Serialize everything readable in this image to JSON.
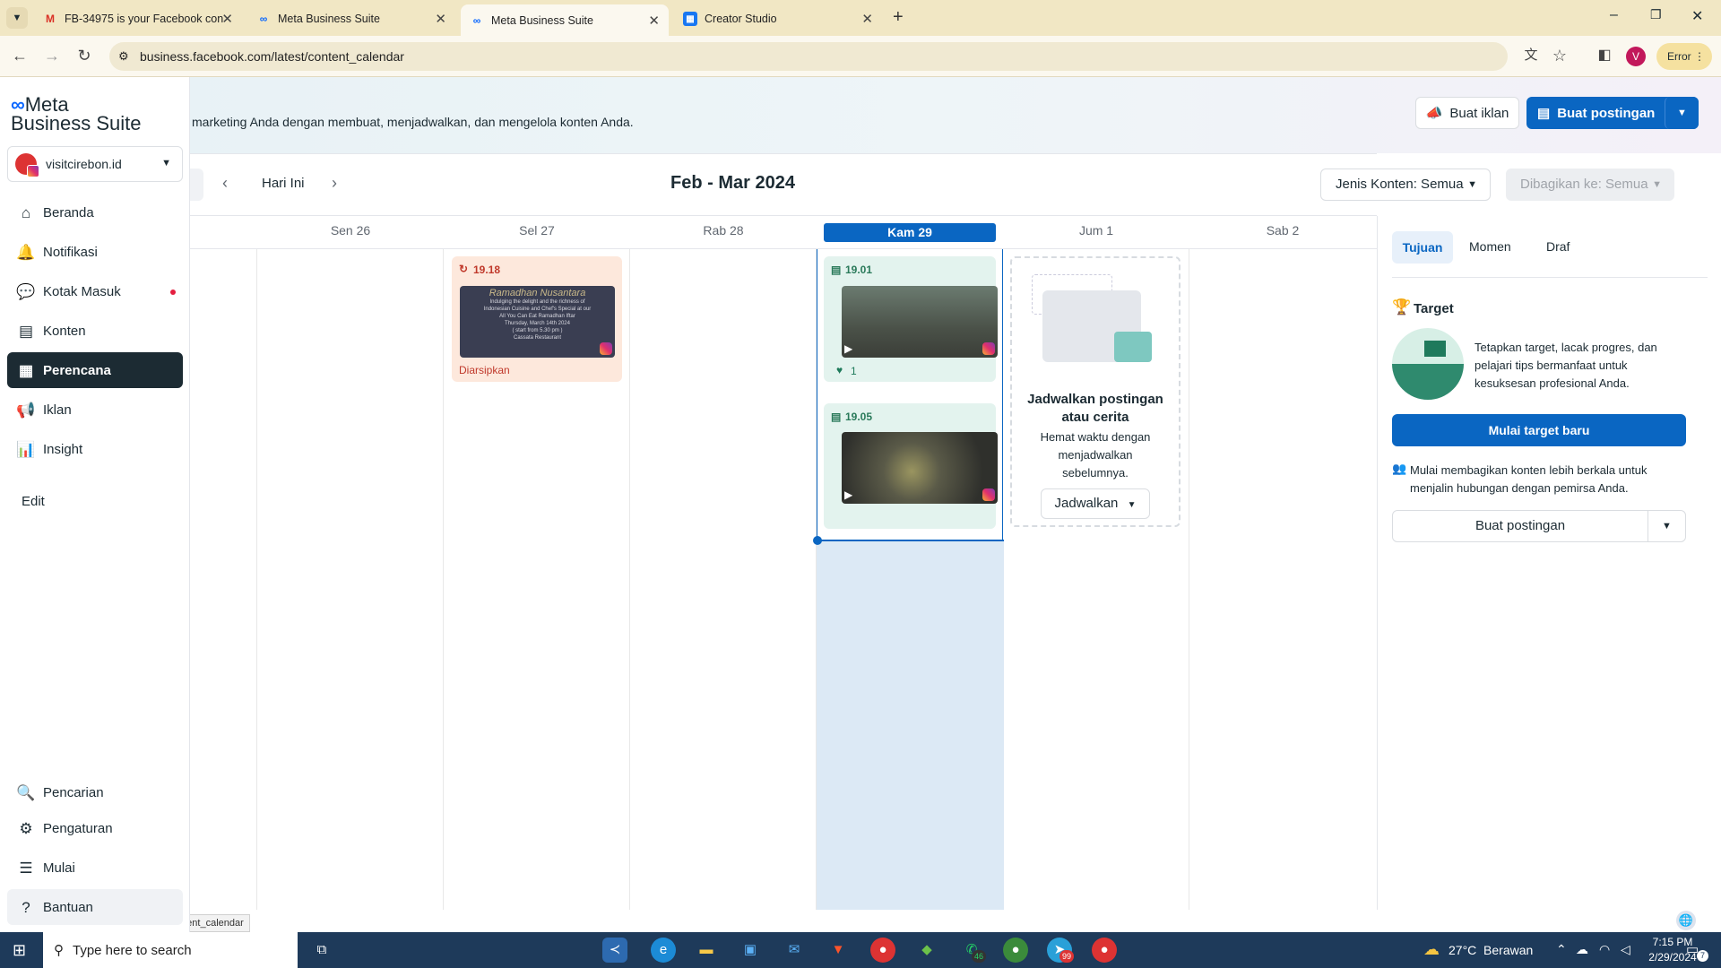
{
  "browser": {
    "tabs": [
      {
        "title": "FB-34975 is your Facebook con",
        "icon": "gmail-icon"
      },
      {
        "title": "Meta Business Suite",
        "icon": "meta-icon"
      },
      {
        "title": "Meta Business Suite",
        "icon": "meta-icon"
      },
      {
        "title": "Creator Studio",
        "icon": "creator-studio-icon"
      }
    ],
    "url": "business.facebook.com/latest/content_calendar",
    "profile_letter": "V",
    "error_label": "Error",
    "status_url": "https://business.facebook.com/latest/content_calendar"
  },
  "app": {
    "logo_line1": "Meta",
    "logo_line2": "Business Suite",
    "account": "visitcirebon.id",
    "banner_text": "marketing Anda dengan membuat, menjadwalkan, dan mengelola konten Anda.",
    "buat_iklan": "Buat iklan",
    "buat_postingan": "Buat postingan",
    "nav": [
      {
        "label": "Beranda",
        "icon": "home-icon"
      },
      {
        "label": "Notifikasi",
        "icon": "bell-icon"
      },
      {
        "label": "Kotak Masuk",
        "icon": "chat-icon"
      },
      {
        "label": "Konten",
        "icon": "content-icon"
      },
      {
        "label": "Perencana",
        "icon": "calendar-icon"
      },
      {
        "label": "Iklan",
        "icon": "megaphone-icon"
      },
      {
        "label": "Insight",
        "icon": "chart-icon"
      }
    ],
    "edit": "Edit",
    "bottom_nav": [
      {
        "label": "Pencarian",
        "icon": "search-icon"
      },
      {
        "label": "Pengaturan",
        "icon": "gear-icon"
      },
      {
        "label": "Mulai",
        "icon": "list-icon"
      },
      {
        "label": "Bantuan",
        "icon": "help-icon"
      }
    ]
  },
  "calendar": {
    "today_label": "Hari Ini",
    "range": "Feb - Mar 2024",
    "filter_content": "Jenis Konten: Semua",
    "filter_shared": "Dibagikan ke: Semua",
    "days": [
      "Sen 26",
      "Sel 27",
      "Rab 28",
      "Kam 29",
      "Jum 1",
      "Sab 2"
    ],
    "posts": {
      "tue_time": "19.18",
      "tue_status": "Diarsipkan",
      "tue_thumb_title": "Ramadhan Nusantara",
      "tue_thumb_lines": [
        "Indulging the delight and the richness of",
        "Indonesian Cuisine and Chef's Special at our",
        "All You Can Eat Ramadhan Iftar",
        "Thursday, March 14th 2024",
        "( start from 5.30 pm )",
        "Cassata Restaurant"
      ],
      "thu_time1": "19.01",
      "thu_likes": "1",
      "thu_time2": "19.05"
    },
    "schedule_card": {
      "title": "Jadwalkan postingan atau cerita",
      "desc": "Hemat waktu dengan menjadwalkan sebelumnya.",
      "button": "Jadwalkan"
    }
  },
  "panel": {
    "tabs": [
      "Tujuan",
      "Momen",
      "Draf"
    ],
    "target_title": "Target",
    "target_desc": "Tetapkan target, lacak progres, dan pelajari tips bermanfaat untuk kesuksesan profesional Anda.",
    "start_button": "Mulai target baru",
    "share_text": "Mulai membagikan konten lebih berkala untuk menjalin hubungan dengan pemirsa Anda.",
    "create_post": "Buat postingan"
  },
  "taskbar": {
    "search_placeholder": "Type here to search",
    "weather": "27°C  Berawan",
    "time": "7:15 PM",
    "date": "2/29/2024",
    "notif_count": "7",
    "whatsapp_badge": "46",
    "telegram_badge": "99"
  }
}
